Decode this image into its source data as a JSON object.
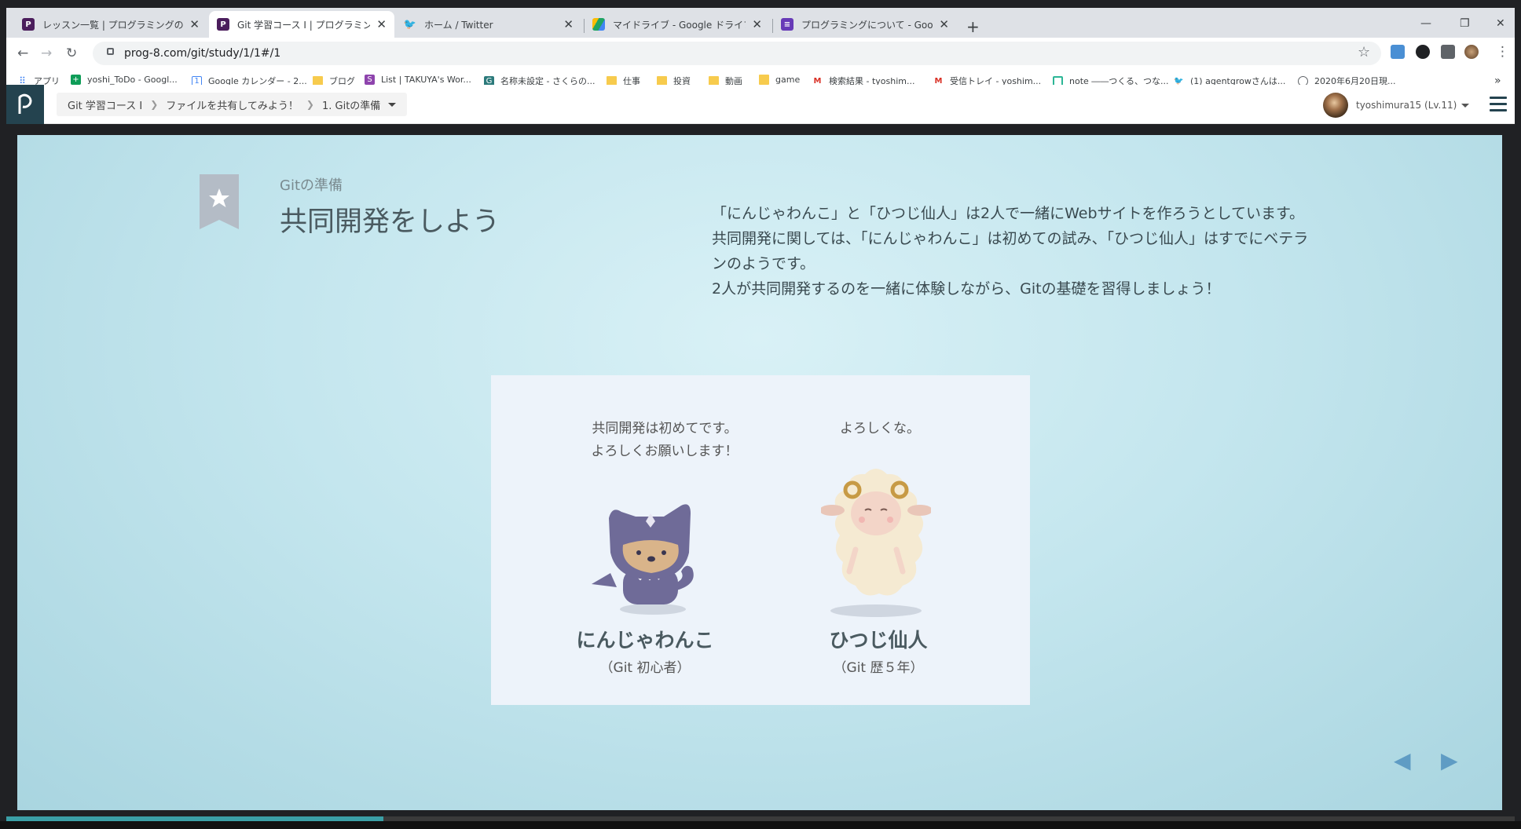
{
  "browser": {
    "tabs": [
      {
        "title": "レッスン一覧 | プログラミングの入門な",
        "icon": "progate-icon",
        "color": "#4b1d5c"
      },
      {
        "title": "Git 学習コース I | プログラミングの入門",
        "icon": "progate-icon",
        "color": "#4b1d5c"
      },
      {
        "title": "ホーム / Twitter",
        "icon": "twitter-icon",
        "color": "#1da1f2"
      },
      {
        "title": "マイドライブ - Google ドライブ",
        "icon": "drive-icon",
        "color": "#1fa463"
      },
      {
        "title": "プログラミングについて - Google フォー",
        "icon": "forms-icon",
        "color": "#673ab7"
      }
    ],
    "new_tab": "+",
    "url": "prog-8.com/git/study/1/1#/1",
    "bookmarks": [
      {
        "label": "アプリ",
        "icon": "apps-icon"
      },
      {
        "label": "yoshi_ToDo - Googl...",
        "icon": "sheets-icon"
      },
      {
        "label": "Google カレンダー - 2...",
        "icon": "calendar-icon"
      },
      {
        "label": "ブログ",
        "icon": "folder-icon"
      },
      {
        "label": "List | TAKUYA's Wor...",
        "icon": "list-icon"
      },
      {
        "label": "名称未設定 - さくらの...",
        "icon": "sakura-icon"
      },
      {
        "label": "仕事",
        "icon": "folder-icon"
      },
      {
        "label": "投資",
        "icon": "folder-icon"
      },
      {
        "label": "動画",
        "icon": "folder-icon"
      },
      {
        "label": "game",
        "icon": "folder-icon"
      },
      {
        "label": "検索結果 - tyoshim...",
        "icon": "gmail-icon"
      },
      {
        "label": "受信トレイ - yoshim...",
        "icon": "gmail-icon"
      },
      {
        "label": "note ――つくる、つな...",
        "icon": "note-icon"
      },
      {
        "label": "(1) agentgrowさんは...",
        "icon": "twitter-icon"
      },
      {
        "label": "2020年6月20日現...",
        "icon": "globe-icon"
      }
    ],
    "more": "»"
  },
  "header": {
    "breadcrumbs": [
      "Git 学習コース I",
      "ファイルを共有してみよう！",
      "1. Gitの準備"
    ],
    "user": "tyoshimura15 (Lv.11)"
  },
  "slide": {
    "subtitle": "Gitの準備",
    "title": "共同開発をしよう",
    "description": [
      "「にんじゃわんこ」と「ひつじ仙人」は2人で一緒にWebサイトを作ろうとしています。",
      "共同開発に関しては、「にんじゃわんこ」は初めての試み、「ひつじ仙人」はすでにベテランのようです。",
      "2人が共同開発するのを一緒に体験しながら、Gitの基礎を習得しましょう！"
    ],
    "characters": [
      {
        "speech": [
          "共同開発は初めてです。",
          "よろしくお願いします！"
        ],
        "name": "にんじゃわんこ",
        "role": "（Git 初心者）"
      },
      {
        "speech": [
          "よろしくな。"
        ],
        "name": "ひつじ仙人",
        "role": "（Git 歴５年）"
      }
    ]
  },
  "nav": {
    "prev": "◀",
    "next": "▶"
  },
  "progress": 0.25
}
